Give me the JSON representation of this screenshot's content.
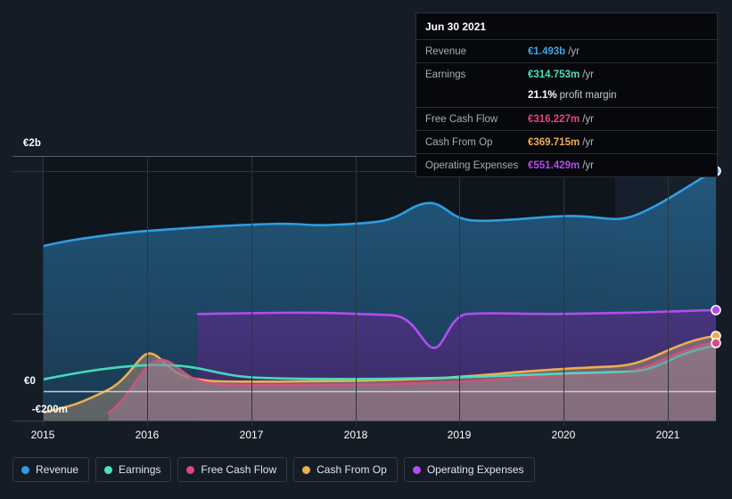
{
  "theme": {
    "background": "#141c26",
    "plot_background": "#0e151d",
    "grid_color": "#2b3640",
    "axis_text": "#ffffff"
  },
  "tooltip": {
    "date": "Jun 30 2021",
    "rows": [
      {
        "name": "Revenue",
        "value": "€1.493b",
        "unit": "/yr",
        "color": "#3ba6e8"
      },
      {
        "name": "Earnings",
        "value": "€314.753m",
        "unit": "/yr",
        "color": "#4ae0c0"
      },
      {
        "name": "",
        "value": "21.1%",
        "sub": "profit margin",
        "color": "#ffffff"
      },
      {
        "name": "Free Cash Flow",
        "value": "€316.227m",
        "unit": "/yr",
        "color": "#e8447f"
      },
      {
        "name": "Cash From Op",
        "value": "€369.715m",
        "unit": "/yr",
        "color": "#f0ad4e"
      },
      {
        "name": "Operating Expenses",
        "value": "€551.429m",
        "unit": "/yr",
        "color": "#b44cf0"
      }
    ]
  },
  "legend": {
    "items": [
      {
        "label": "Revenue",
        "color": "#2f9ee0"
      },
      {
        "label": "Earnings",
        "color": "#4ae0c0"
      },
      {
        "label": "Free Cash Flow",
        "color": "#d94a80"
      },
      {
        "label": "Cash From Op",
        "color": "#f0ad4e"
      },
      {
        "label": "Operating Expenses",
        "color": "#b44cf0"
      }
    ]
  },
  "chart_data": {
    "type": "area",
    "title": "",
    "xlabel": "",
    "ylabel": "",
    "grid": true,
    "legend_position": "bottom",
    "x_ticks": [
      "2015",
      "2016",
      "2017",
      "2018",
      "2019",
      "2020",
      "2021"
    ],
    "x_tick_values": [
      2015,
      2016,
      2017,
      2018,
      2019,
      2020,
      2021
    ],
    "y_ticks": [
      "€2b",
      "€0",
      "-€200m"
    ],
    "y_tick_values": [
      2000,
      0,
      -200
    ],
    "ylim": [
      -280,
      2100
    ],
    "xlim": [
      2014.85,
      2021.55
    ],
    "units": "EUR millions per year",
    "series": [
      {
        "name": "Revenue",
        "color": "#2f9ee0",
        "fill": "#1d4565",
        "x": [
          2014.9,
          2015.25,
          2015.6,
          2016.0,
          2016.4,
          2016.8,
          2017.15,
          2017.5,
          2017.75,
          2018.0,
          2018.3,
          2018.55,
          2018.7,
          2018.9,
          2019.1,
          2019.4,
          2019.75,
          2020.0,
          2020.3,
          2020.6,
          2020.85,
          2021.15,
          2021.45
        ],
        "y": [
          1318,
          1340,
          1372,
          1400,
          1415,
          1424,
          1430,
          1436,
          1424,
          1428,
          1438,
          1520,
          1586,
          1500,
          1452,
          1456,
          1468,
          1482,
          1470,
          1452,
          1456,
          1530,
          1493
        ],
        "end_marker": true
      },
      {
        "name": "Operating Expenses",
        "color": "#b44cf0",
        "fill": "#3d2a66",
        "x": [
          2016.45,
          2016.8,
          2017.2,
          2017.6,
          2017.9,
          2018.2,
          2018.45,
          2018.62,
          2018.8,
          2018.95,
          2019.15,
          2019.5,
          2019.9,
          2020.3,
          2020.7,
          2021.1,
          2021.45
        ],
        "y": [
          702,
          706,
          710,
          706,
          700,
          698,
          660,
          540,
          600,
          700,
          706,
          700,
          698,
          700,
          706,
          716,
          551
        ],
        "end_marker": true
      },
      {
        "name": "Cash From Op",
        "color": "#f0ad4e",
        "fill": "#6b5a45",
        "x": [
          2014.9,
          2015.2,
          2015.5,
          2015.75,
          2016.0,
          2016.2,
          2016.5,
          2016.9,
          2017.3,
          2017.7,
          2018.1,
          2018.5,
          2018.9,
          2019.3,
          2019.7,
          2020.1,
          2020.5,
          2020.85,
          2021.15,
          2021.45
        ],
        "y": [
          -196,
          -170,
          -120,
          -20,
          150,
          190,
          120,
          75,
          72,
          78,
          80,
          85,
          92,
          110,
          130,
          150,
          160,
          185,
          300,
          370
        ],
        "end_marker": true
      },
      {
        "name": "Free Cash Flow",
        "color": "#d94a80",
        "fill": "#6b3a55",
        "x": [
          2015.55,
          2015.8,
          2016.05,
          2016.25,
          2016.55,
          2016.95,
          2017.35,
          2017.75,
          2018.15,
          2018.55,
          2018.95,
          2019.35,
          2019.75,
          2020.15,
          2020.55,
          2020.9,
          2021.2,
          2021.45
        ],
        "y": [
          -195,
          -110,
          60,
          140,
          90,
          35,
          32,
          36,
          40,
          44,
          50,
          64,
          80,
          96,
          108,
          130,
          250,
          316
        ],
        "end_marker": true
      },
      {
        "name": "Earnings",
        "color": "#4ae0c0",
        "fill": "#2a5d58",
        "x": [
          2014.9,
          2015.3,
          2015.7,
          2016.05,
          2016.4,
          2016.8,
          2017.2,
          2017.6,
          2018.0,
          2018.4,
          2018.8,
          2019.2,
          2019.6,
          2020.0,
          2020.4,
          2020.8,
          2021.15,
          2021.45
        ],
        "y": [
          26,
          48,
          72,
          86,
          92,
          90,
          60,
          48,
          44,
          46,
          48,
          52,
          58,
          64,
          70,
          80,
          200,
          315
        ],
        "end_marker": false
      }
    ],
    "annotations": [
      {
        "type": "forecast-band",
        "from_x": 2020.75,
        "to_x": 2021.55,
        "note": "lighter shaded band on right"
      }
    ]
  }
}
